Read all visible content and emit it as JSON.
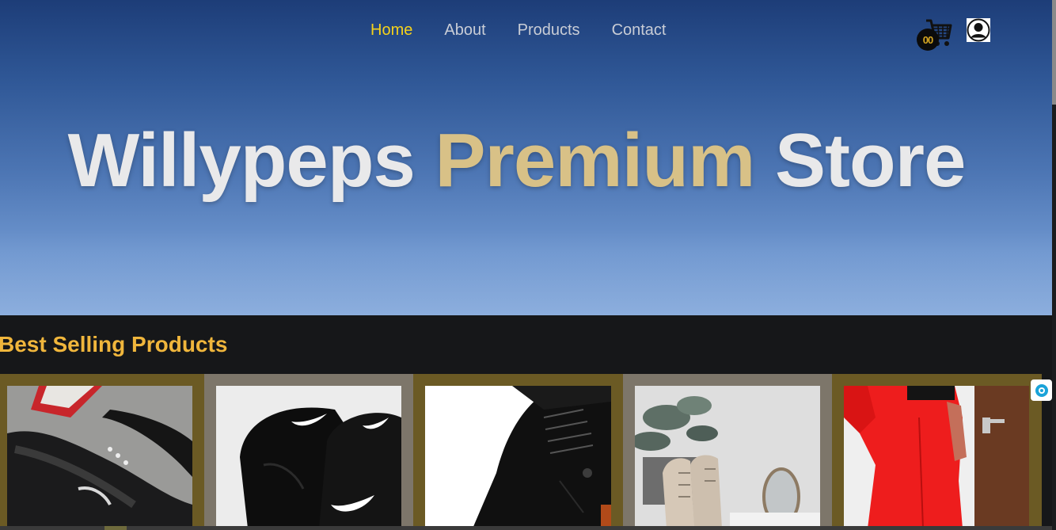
{
  "nav": {
    "items": [
      {
        "label": "Home",
        "active": true
      },
      {
        "label": "About",
        "active": false
      },
      {
        "label": "Products",
        "active": false
      },
      {
        "label": "Contact",
        "active": false
      }
    ]
  },
  "header": {
    "cart_count": "00",
    "cart_icon": "shopping-cart-icon",
    "user_icon": "user-avatar-icon"
  },
  "hero": {
    "title_part1": "Willypeps ",
    "title_accent": "Premium",
    "title_part2": " Store"
  },
  "section": {
    "title": "Best Selling Products"
  },
  "products": [
    {
      "image": "black-nike-air-max-sneaker"
    },
    {
      "image": "black-nike-high-top-sneakers"
    },
    {
      "image": "black-leather-boot"
    },
    {
      "image": "beige-lace-up-ankle-boots"
    },
    {
      "image": "red-jumpsuit-outfit"
    }
  ],
  "colors": {
    "accent_yellow": "#f6d21a",
    "accent_gold": "#d8c187",
    "section_title": "#f0b63c",
    "card_olive": "#6b5a24",
    "card_grey": "#7d766a"
  }
}
